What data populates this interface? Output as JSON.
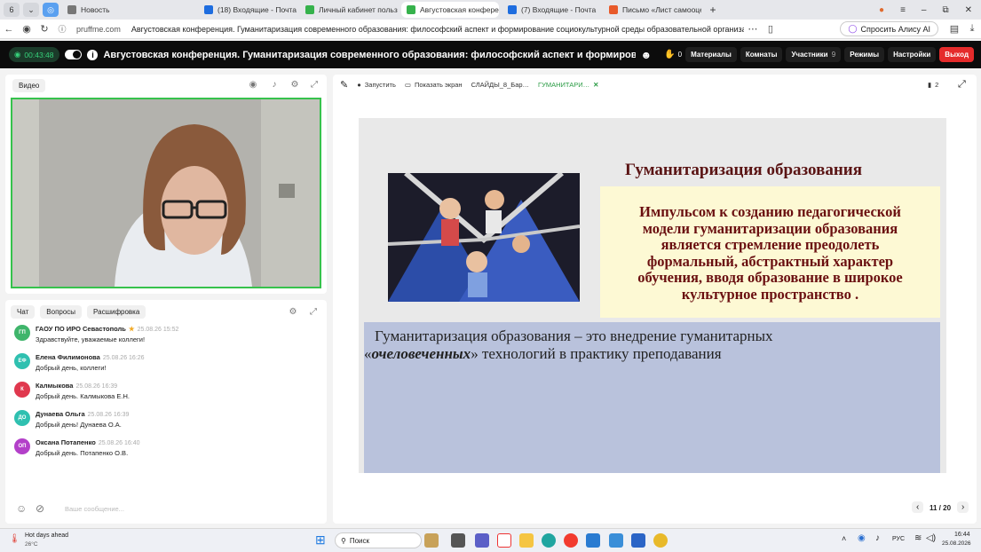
{
  "browser": {
    "tabs": [
      {
        "label": "Новость",
        "color": "#777777"
      },
      {
        "label": "(18) Входящие - Почта М…",
        "color": "#1e6ddf"
      },
      {
        "label": "Личный кабинет пользов…",
        "color": "#36b24c"
      },
      {
        "label": "Августовская конфере…",
        "color": "#36b24c",
        "active": true
      },
      {
        "label": "(7) Входящие - Почта",
        "color": "#1e6ddf"
      },
      {
        "label": "Письмо «Лист самооцен…",
        "color": "#e85a2a"
      }
    ],
    "profile_badge": "6",
    "domain": "pruffme.com",
    "page_title": "Августовская конференция. Гуманитаризация современного образования: философский аспект и формирование социокультурной среды образовательной организации",
    "alisa_button": "Спросить Алису AI"
  },
  "header": {
    "timer": "00:43:48",
    "conference_title": "Августовская конференция. Гуманитаризация современного образования: философский аспект и формирование …",
    "hand_count": "0",
    "buttons": {
      "materials": "Материалы",
      "rooms": "Комнаты",
      "participants": "Участники",
      "participants_count": "9",
      "modes": "Режимы",
      "settings": "Настройки",
      "exit": "Выход"
    }
  },
  "video_panel": {
    "label": "Видео"
  },
  "chat": {
    "tabs": [
      "Чат",
      "Вопросы",
      "Расшифровка"
    ],
    "messages": [
      {
        "initials": "ГП",
        "color": "#3fb56b",
        "name": "ГАОУ ПО ИРО Севастополь",
        "star": "★",
        "time": "25.08.26 15:52",
        "text": "Здравствуйте, уважаемые коллеги!"
      },
      {
        "initials": "ЕФ",
        "color": "#2fc0b0",
        "name": "Елена Филимонова",
        "time": "25.08.26 16:26",
        "text": "Добрый день, коллеги!"
      },
      {
        "initials": "К",
        "color": "#e0384e",
        "name": "Калмыкова",
        "time": "25.08.26 16:39",
        "text": "Добрый день. Калмыкова Е.Н."
      },
      {
        "initials": "ДО",
        "color": "#2fc0b0",
        "name": "Дунаева Ольга",
        "time": "25.08.26 16:39",
        "text": "Добрый день! Дунаева О.А."
      },
      {
        "initials": "ОП",
        "color": "#b340c9",
        "name": "Оксана Потапенко",
        "time": "25.08.26 16:40",
        "text": "Добрый день. Потапенко О.В."
      }
    ],
    "input_placeholder": "Ваше сообщение..."
  },
  "presentation": {
    "toolbar": {
      "start": "Запустить",
      "share_screen": "Показать экран",
      "file1": "СЛАЙДЫ_8_Бар…",
      "file2": "ГУМАНИТАРИ…",
      "bookmarks": "2"
    },
    "slide": {
      "title": "Гуманитаризация образования",
      "box_lines": [
        "Импульсом  к созданию педагогической",
        "модели гуманитаризации образования",
        "является стремление преодолеть",
        "формальный, абстрактный характер",
        "обучения, вводя образование в широкое",
        "культурное пространство ."
      ],
      "lower_line1": "Гуманитаризация   образования   –   это   внедрение   гуманитарных",
      "lower_quote_open": "«",
      "lower_emph": "очеловеченных",
      "lower_rest": "»   технологий в  практику    преподавания"
    },
    "pager": "11 / 20"
  },
  "taskbar": {
    "weather_title": "Hot days ahead",
    "weather_temp": "26°C",
    "search": "Поиск",
    "lang": "РУС",
    "time": "16:44",
    "date": "25.08.2026"
  }
}
